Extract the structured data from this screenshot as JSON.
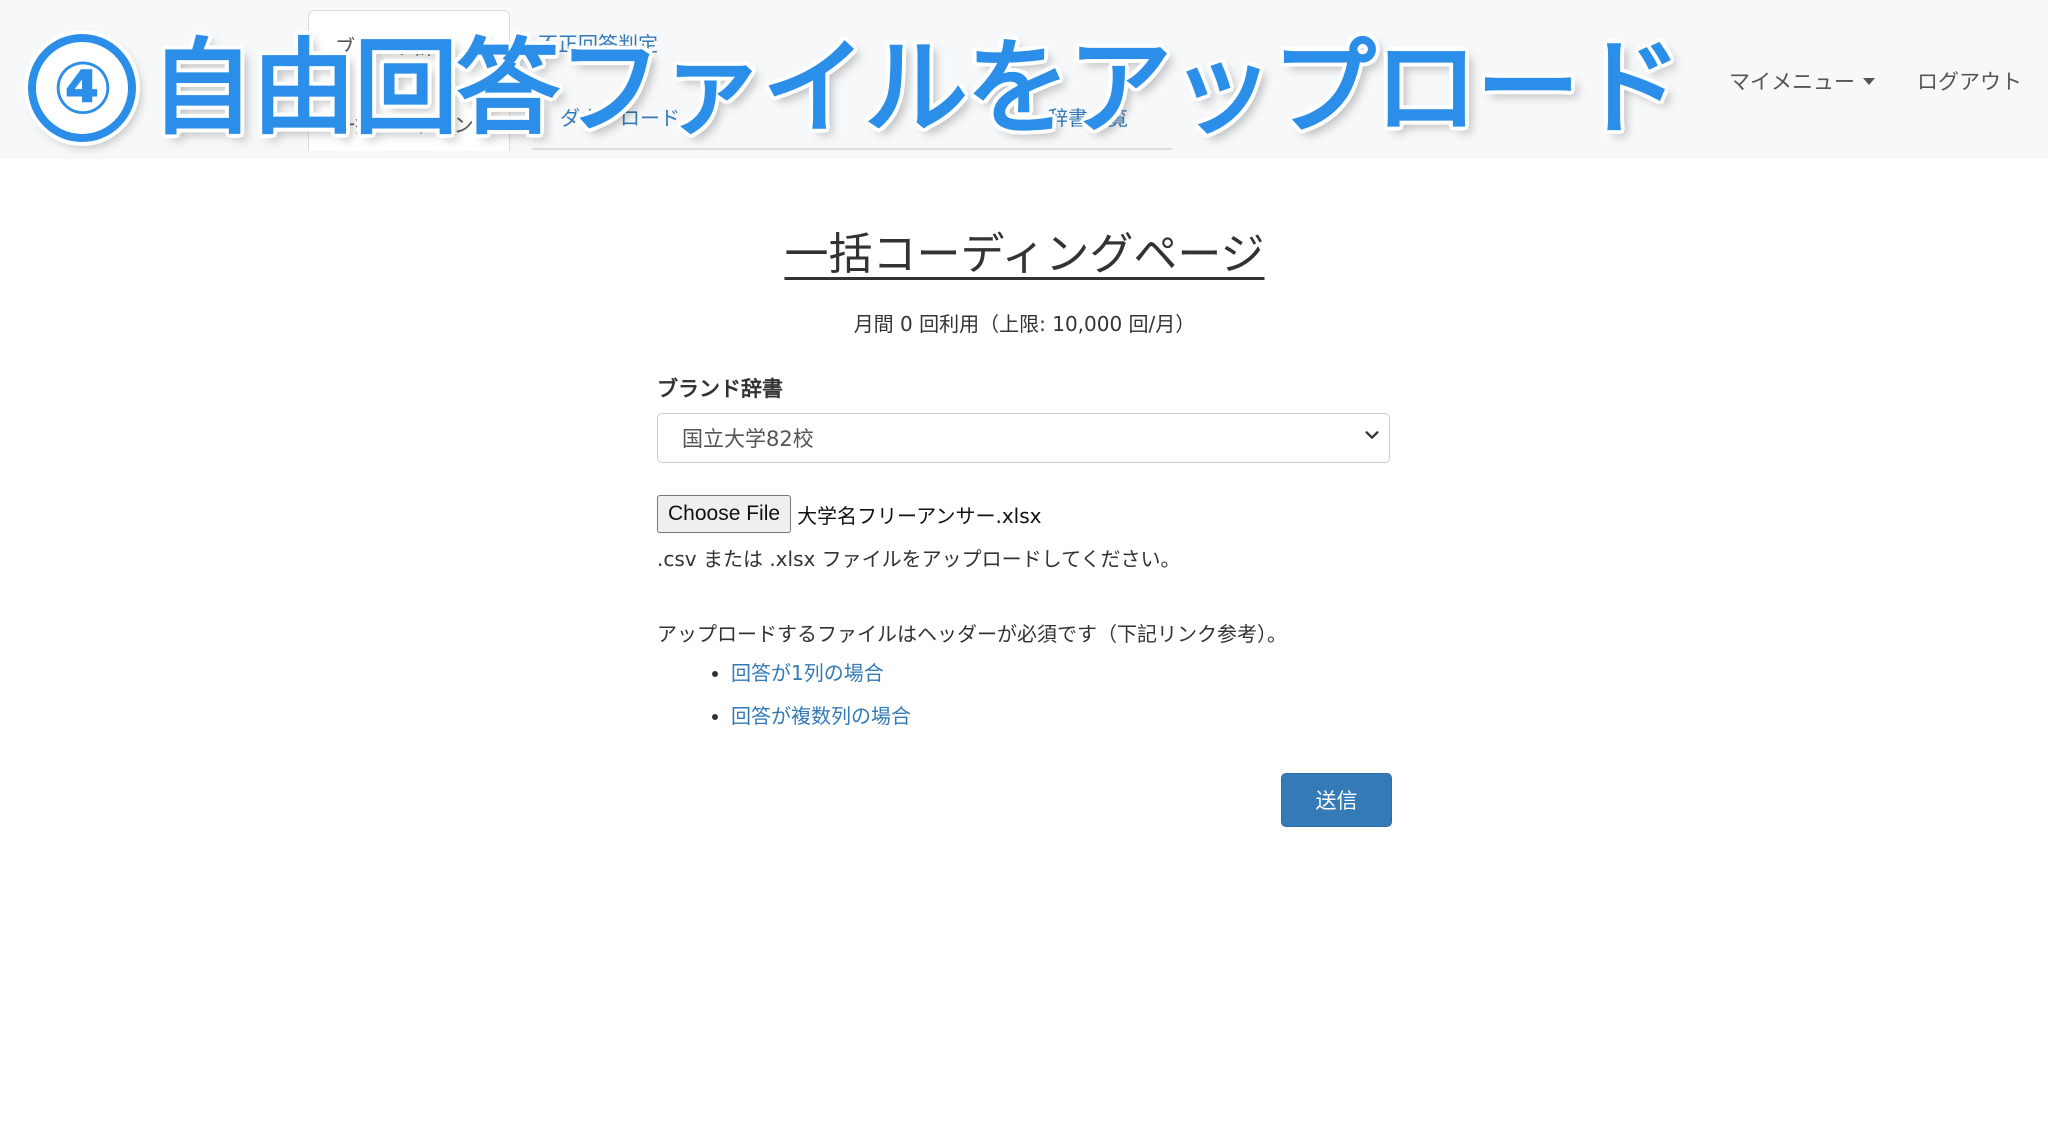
{
  "overlay": {
    "step_number": "④",
    "step_title": "自由回答ファイルをアップロード"
  },
  "navbar": {
    "tabs": {
      "active_top": "ブランド辞書",
      "active_bottom": "一括コーディング",
      "fraud_check": "不正回答判定",
      "download": "ダウンロード",
      "dictionary_list": "辞書一覧"
    },
    "my_menu": "マイメニュー",
    "logout": "ログアウト"
  },
  "main": {
    "title": "一括コーディングページ",
    "usage": "月間 0 回利用（上限: 10,000 回/月）",
    "brand_dictionary_label": "ブランド辞書",
    "brand_dictionary_selected": "国立大学82校",
    "file": {
      "button_label": "Choose File",
      "selected_file": "大学名フリーアンサー.xlsx",
      "help": ".csv または .xlsx ファイルをアップロードしてください。"
    },
    "header_note": "アップロードするファイルはヘッダーが必須です（下記リンク参考）。",
    "links": [
      "回答が1列の場合",
      "回答が複数列の場合"
    ],
    "submit_label": "送信"
  },
  "colors": {
    "link": "#337ab7",
    "primary_button": "#337ab7",
    "overlay_text": "#2b8ee8",
    "navbar_bg": "#f7f8fa"
  }
}
